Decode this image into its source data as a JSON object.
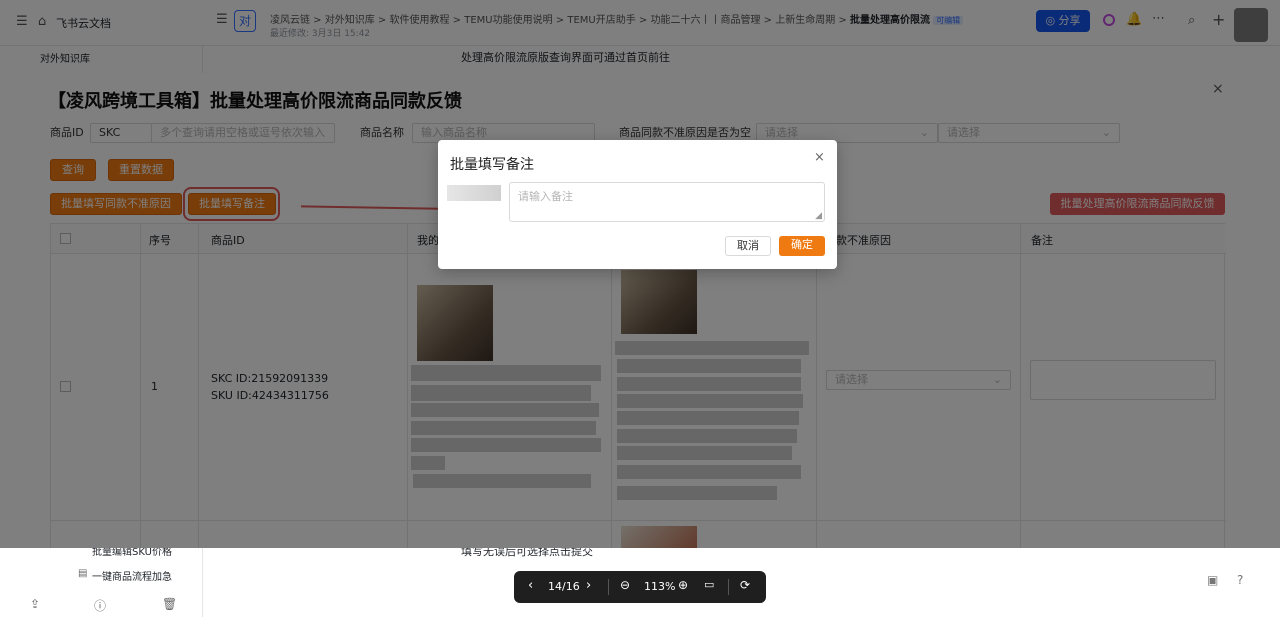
{
  "top": {
    "workspace": "飞书云文档",
    "avatar_char": "对",
    "breadcrumbs": [
      "凌风云链",
      "对外知识库",
      "软件使用教程",
      "TEMU功能使用说明",
      "TEMU开店助手",
      "功能二十六丨丨商品管理",
      "上新生命周期",
      "批量处理高价限流"
    ],
    "edit_meta": "最近修改: 3月3日 15:42",
    "share": "分享",
    "page_badge": "可编辑"
  },
  "sidebar": {
    "kb_title": "对外知识库",
    "items": [
      "批量编辑SKU价格",
      "一键商品流程加急"
    ]
  },
  "doc": {
    "top_text": "处理高价限流原版查询界面可通过首页前往",
    "bottom_text": "填写无误后可选择点击提交"
  },
  "panel": {
    "title": "【凌风跨境工具箱】批量处理高价限流商品同款反馈",
    "filters": {
      "product_id_label": "商品ID",
      "id_type": "SKC",
      "id_placeholder": "多个查询请用空格或逗号依次输入",
      "name_label": "商品名称",
      "name_placeholder": "输入商品名称",
      "reason_label": "商品同款不准原因是否为空",
      "select1_placeholder": "请选择",
      "select2_placeholder": "请选择"
    },
    "buttons": {
      "query": "查询",
      "reset": "重置数据",
      "batch_reason": "批量填写同款不准原因",
      "batch_note": "批量填写备注",
      "batch_submit": "批量处理高价限流商品同款反馈"
    },
    "table": {
      "headers": [
        "序号",
        "商品ID",
        "我的",
        "款不准原因",
        "备注"
      ],
      "row": {
        "index": "1",
        "skc": "SKC ID:21592091339",
        "sku": "SKU ID:42434311756",
        "select_placeholder": "请选择"
      }
    }
  },
  "modal": {
    "title": "批量填写备注",
    "placeholder": "请输入备注",
    "cancel": "取消",
    "confirm": "确定"
  },
  "pager": {
    "page": "14/16",
    "zoom": "113%"
  },
  "colors": {
    "accent": "#f07a12",
    "danger": "#e05a5a",
    "share": "#1456f0"
  }
}
